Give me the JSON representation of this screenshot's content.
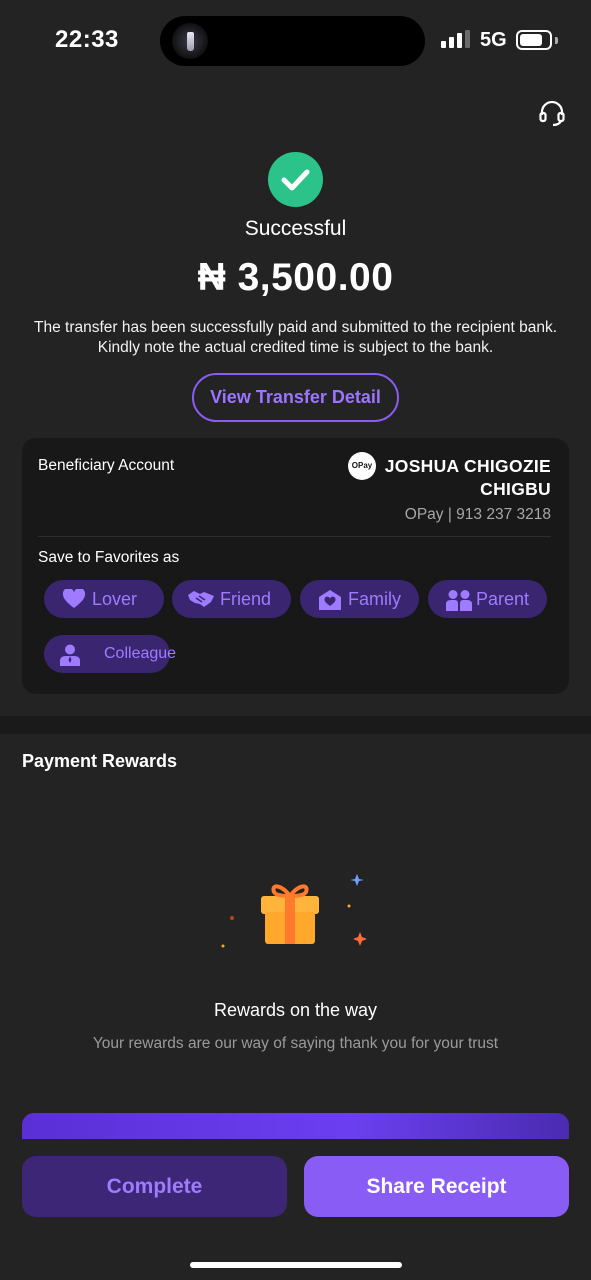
{
  "status_bar": {
    "time": "22:33",
    "network": "5G"
  },
  "header": {
    "support_icon": "headset-icon"
  },
  "result": {
    "status": "Successful",
    "amount": "₦ 3,500.00",
    "note": "The transfer has been successfully paid and submitted to the recipient bank. Kindly note the actual credited time is subject to the bank.",
    "view_detail_label": "View Transfer Detail"
  },
  "beneficiary": {
    "label": "Beneficiary Account",
    "bank_logo": "OPay",
    "name": "JOSHUA CHIGOZIE CHIGBU",
    "account": "OPay | 913 237 3218",
    "favorites_label": "Save to Favorites as",
    "favorites": [
      {
        "label": "Lover",
        "icon": "heart-icon"
      },
      {
        "label": "Friend",
        "icon": "handshake-icon"
      },
      {
        "label": "Family",
        "icon": "family-heart-icon"
      },
      {
        "label": "Parent",
        "icon": "parents-icon"
      },
      {
        "label": "Colleague",
        "icon": "colleague-icon"
      }
    ]
  },
  "rewards": {
    "title": "Payment Rewards",
    "heading": "Rewards on the way",
    "subtext": "Your rewards are our way of saying thank you for your trust"
  },
  "actions": {
    "complete_label": "Complete",
    "share_label": "Share Receipt"
  },
  "colors": {
    "accent": "#8a5cf6",
    "success": "#2cc38a",
    "chip_bg": "#3a2670",
    "background": "#232323"
  }
}
